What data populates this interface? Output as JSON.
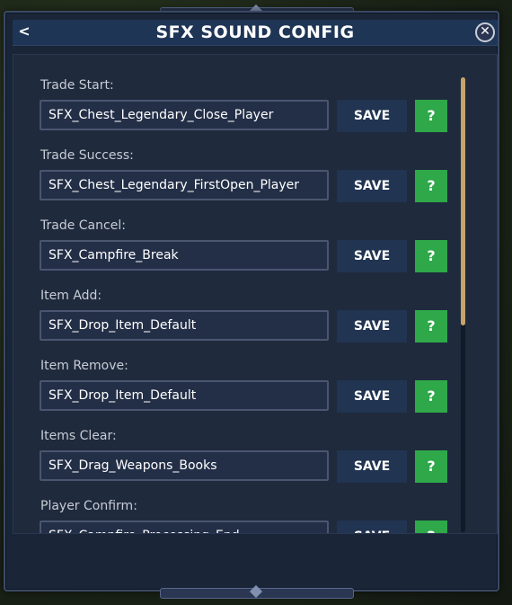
{
  "header": {
    "title": "SFX SOUND CONFIG",
    "back_label": "<",
    "close_label": "✕"
  },
  "colors": {
    "panel": "#1a2538",
    "title_bar": "#1f3556",
    "save_button": "#213451",
    "help_button": "#2fa84a",
    "scroll_thumb": "#c7a46a"
  },
  "icons": {
    "back": "chevron-left-icon",
    "close": "close-icon",
    "help": "question-icon"
  },
  "entries": [
    {
      "label": "Trade Start:",
      "value": "SFX_Chest_Legendary_Close_Player",
      "save_label": "SAVE",
      "help_label": "?"
    },
    {
      "label": "Trade Success:",
      "value": "SFX_Chest_Legendary_FirstOpen_Player",
      "save_label": "SAVE",
      "help_label": "?"
    },
    {
      "label": "Trade Cancel:",
      "value": "SFX_Campfire_Break",
      "save_label": "SAVE",
      "help_label": "?"
    },
    {
      "label": "Item Add:",
      "value": "SFX_Drop_Item_Default",
      "save_label": "SAVE",
      "help_label": "?"
    },
    {
      "label": "Item Remove:",
      "value": "SFX_Drop_Item_Default",
      "save_label": "SAVE",
      "help_label": "?"
    },
    {
      "label": "Items Clear:",
      "value": "SFX_Drag_Weapons_Books",
      "save_label": "SAVE",
      "help_label": "?"
    },
    {
      "label": "Player Confirm:",
      "value": "SFX_Campfire_Processing_End",
      "save_label": "SAVE",
      "help_label": "?"
    }
  ]
}
